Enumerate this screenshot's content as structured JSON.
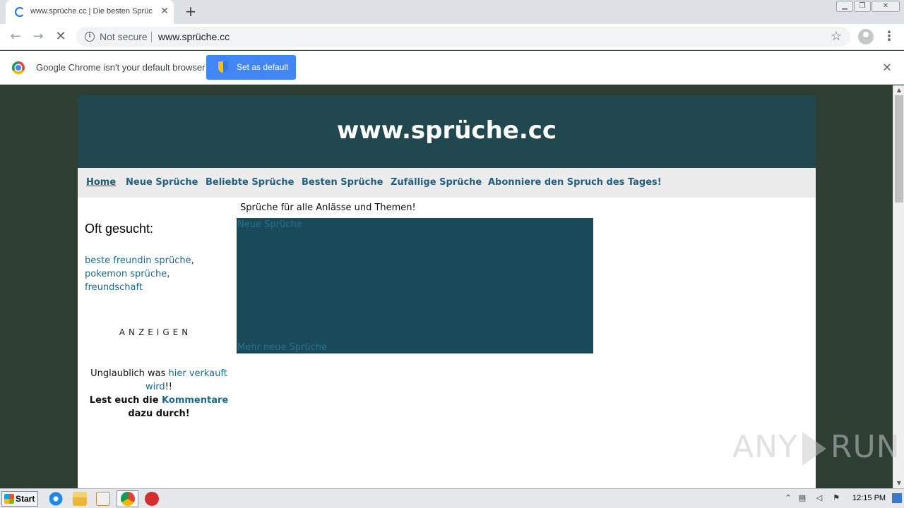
{
  "browser": {
    "tab_title": "www.sprüche.cc | Die besten Sprüc",
    "tab_close": "✕",
    "new_tab": "+",
    "security_label": "Not secure",
    "url": "www.sprüche.cc",
    "infobar_message": "Google Chrome isn't your default browser",
    "set_default_label": "Set as default",
    "infobar_close": "✕"
  },
  "site": {
    "title": "www.sprüche.cc",
    "nav": [
      {
        "label": "Home"
      },
      {
        "label": "Neue Sprüche"
      },
      {
        "label": "Beliebte Sprüche"
      },
      {
        "label": "Besten Sprüche"
      },
      {
        "label": "Zufällige Sprüche"
      },
      {
        "label": "Abonniere den Spruch des Tages!"
      }
    ],
    "sidebar": {
      "heading": "Oft gesucht:",
      "tags": [
        "beste freundin sprüche",
        "pokemon sprüche",
        "freundschaft"
      ],
      "separator": ",",
      "ads_label": "ANZEIGEN",
      "promo_text1": "Unglaublich was ",
      "promo_link1": "hier verkauft wird",
      "promo_text2": "!!",
      "promo_text3": "Lest euch die ",
      "promo_link2": "Kommentare",
      "promo_text4": "dazu durch!"
    },
    "main": {
      "intro": "Sprüche für alle Anlässe und Themen!",
      "feed_link": "Neue Sprüche",
      "more_link": "Mehr neue Sprüche"
    }
  },
  "watermark": {
    "left": "ANY",
    "right": "RUN"
  },
  "taskbar": {
    "start_label": "Start",
    "clock": "12:15 PM"
  }
}
